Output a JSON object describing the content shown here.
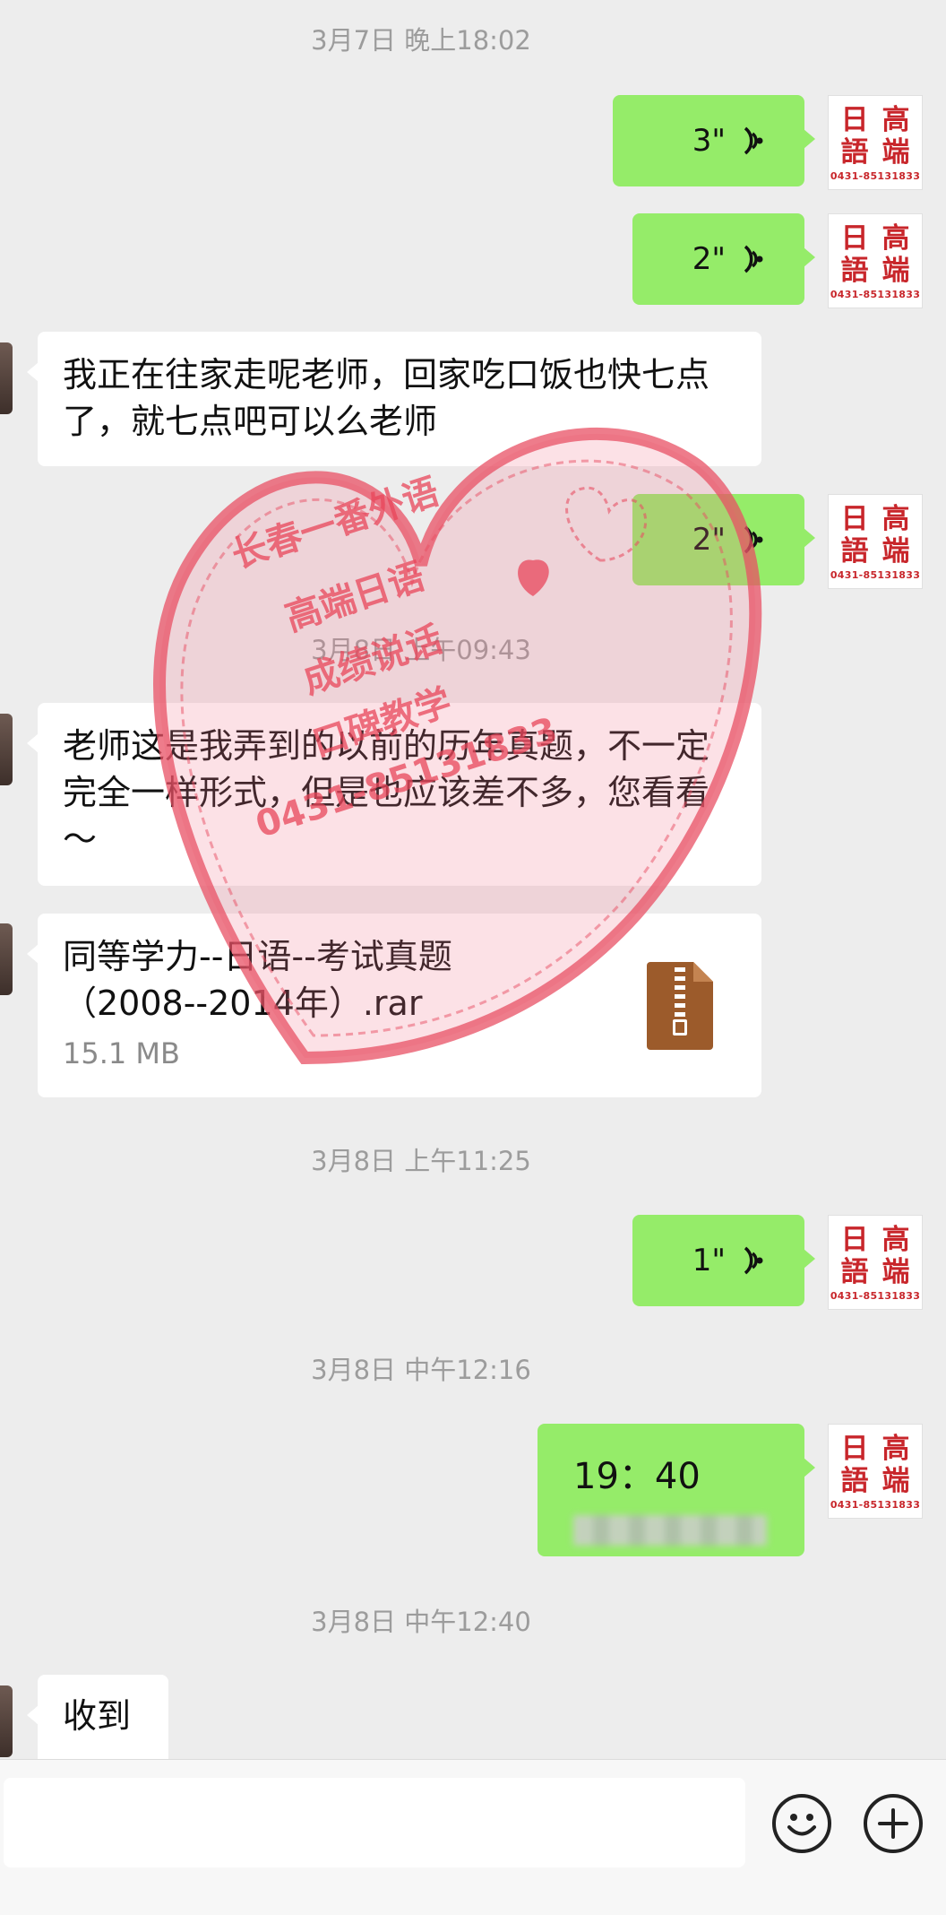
{
  "timestamps": [
    "3月7日 晚上18:02",
    "3月8日 上午09:43",
    "3月8日 上午11:25",
    "3月8日 中午12:16",
    "3月8日 中午12:40"
  ],
  "avatar": {
    "seal_chars": [
      "日",
      "高",
      "語",
      "端"
    ],
    "phone": "0431-85131833"
  },
  "voice_messages": [
    {
      "duration": "3\""
    },
    {
      "duration": "2\""
    },
    {
      "duration": "2\""
    },
    {
      "duration": "1\""
    }
  ],
  "text_messages": {
    "msg1": "我正在往家走呢老师，回家吃口饭也快七点了，就七点吧可以么老师",
    "msg2": "老师这是我弄到的以前的历年真题，不一定完全一样形式，但是也应该差不多，您看看～",
    "reply_time": "19：40",
    "last": "收到"
  },
  "file": {
    "name": "同等学力--日语--考试真题（2008--2014年）.rar",
    "size": "15.1 MB"
  },
  "watermark": {
    "lines": [
      "长春一番外语",
      "高端日语",
      "成绩说话",
      "口碑教学",
      "0431-85131833"
    ]
  },
  "colors": {
    "sent_bubble": "#95ec69",
    "received_bubble": "#ffffff",
    "background": "#ededed",
    "seal_red": "#c8262b"
  }
}
